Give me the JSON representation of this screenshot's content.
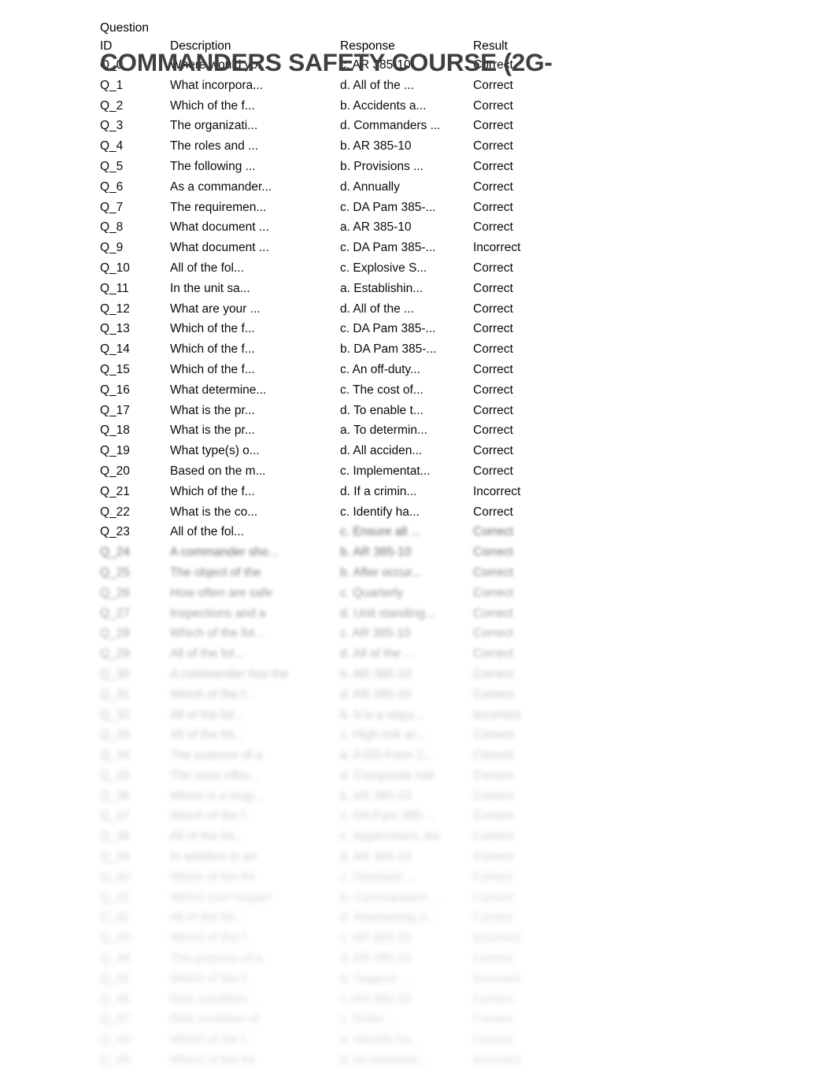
{
  "document": {
    "title": "COMMANDERS SAFETY COURSE (2G-",
    "background_color": "#ffffff",
    "title_color": "#3f3f3f",
    "text_color": "#0a0a0a"
  },
  "table": {
    "headers": {
      "id_line1": "Question",
      "id_line2": "ID",
      "description": "Description",
      "response": "Response",
      "result": "Result"
    },
    "rows": [
      {
        "id": "Q_0",
        "description": "Where would yo...",
        "response": "c. AR 385-10",
        "result": "Correct",
        "blur": 0
      },
      {
        "id": "Q_1",
        "description": "What incorpora...",
        "response": "d. All of the ...",
        "result": "Correct",
        "blur": 0
      },
      {
        "id": "Q_2",
        "description": "Which of the f...",
        "response": "b. Accidents a...",
        "result": "Correct",
        "blur": 0
      },
      {
        "id": "Q_3",
        "description": "The organizati...",
        "response": "d. Commanders ...",
        "result": "Correct",
        "blur": 0
      },
      {
        "id": "Q_4",
        "description": "The roles and ...",
        "response": "b. AR 385-10",
        "result": "Correct",
        "blur": 0
      },
      {
        "id": "Q_5",
        "description": "The following ...",
        "response": "b. Provisions ...",
        "result": "Correct",
        "blur": 0
      },
      {
        "id": "Q_6",
        "description": "As a commander...",
        "response": "d. Annually",
        "result": "Correct",
        "blur": 0
      },
      {
        "id": "Q_7",
        "description": "The requiremen...",
        "response": "c. DA Pam 385-...",
        "result": "Correct",
        "blur": 0
      },
      {
        "id": "Q_8",
        "description": "What document ...",
        "response": "a. AR 385-10",
        "result": "Correct",
        "blur": 0
      },
      {
        "id": "Q_9",
        "description": "What document ...",
        "response": "c. DA Pam 385-...",
        "result": "Incorrect",
        "blur": 0
      },
      {
        "id": "Q_10",
        "description": "All of the fol...",
        "response": "c. Explosive S...",
        "result": "Correct",
        "blur": 0
      },
      {
        "id": "Q_11",
        "description": "In the unit sa...",
        "response": "a. Establishin...",
        "result": "Correct",
        "blur": 0
      },
      {
        "id": "Q_12",
        "description": "What are your ...",
        "response": "d. All of the ...",
        "result": "Correct",
        "blur": 0
      },
      {
        "id": "Q_13",
        "description": "Which of the f...",
        "response": "c. DA Pam 385-...",
        "result": "Correct",
        "blur": 0
      },
      {
        "id": "Q_14",
        "description": "Which of the f...",
        "response": "b. DA Pam 385-...",
        "result": "Correct",
        "blur": 0
      },
      {
        "id": "Q_15",
        "description": "Which of the f...",
        "response": "c. An off-duty...",
        "result": "Correct",
        "blur": 0
      },
      {
        "id": "Q_16",
        "description": "What determine...",
        "response": "c. The cost of...",
        "result": "Correct",
        "blur": 0
      },
      {
        "id": "Q_17",
        "description": "What is the pr...",
        "response": "d. To enable t...",
        "result": "Correct",
        "blur": 0
      },
      {
        "id": "Q_18",
        "description": "What is the pr...",
        "response": "a. To determin...",
        "result": "Correct",
        "blur": 0
      },
      {
        "id": "Q_19",
        "description": "What type(s) o...",
        "response": "d. All acciden...",
        "result": "Correct",
        "blur": 0
      },
      {
        "id": "Q_20",
        "description": "Based on the m...",
        "response": "c. Implementat...",
        "result": "Correct",
        "blur": 0
      },
      {
        "id": "Q_21",
        "description": "Which of the f...",
        "response": "d. If a crimin...",
        "result": "Incorrect",
        "blur": 0
      },
      {
        "id": "Q_22",
        "description": "What is the co...",
        "response": "c. Identify ha...",
        "result": "Correct",
        "blur": 0
      },
      {
        "id": "Q_23",
        "description": "All of the fol...",
        "response": "c. Ensure all ...",
        "result": "Correct",
        "blur": 0,
        "blur_tail": true
      },
      {
        "id": "Q_24",
        "description": "A commander sho...",
        "response": "b. AR 385-10",
        "result": "Correct",
        "blur": 1
      },
      {
        "id": "Q_25",
        "description": "The object of the",
        "response": "b. After occur...",
        "result": "Correct",
        "blur": 1
      },
      {
        "id": "Q_26",
        "description": "How often are safe",
        "response": "c. Quarterly",
        "result": "Correct",
        "blur": 1
      },
      {
        "id": "Q_27",
        "description": "Inspections and a",
        "response": "d. Unit standing...",
        "result": "Correct",
        "blur": 1
      },
      {
        "id": "Q_28",
        "description": "Which of the fol...",
        "response": "c. AR 385-10",
        "result": "Correct",
        "blur": 1
      },
      {
        "id": "Q_29",
        "description": "All of the fol...",
        "response": "d. All of the ...",
        "result": "Correct",
        "blur": 1
      },
      {
        "id": "Q_30",
        "description": "A commander has the",
        "response": "b. AR 385-10",
        "result": "Correct",
        "blur": 2
      },
      {
        "id": "Q_31",
        "description": "Which of the f...",
        "response": "d. AR 385-10",
        "result": "Correct",
        "blur": 2
      },
      {
        "id": "Q_32",
        "description": "All of the fol...",
        "response": "b. It is a requi...",
        "result": "Incorrect",
        "blur": 2
      },
      {
        "id": "Q_33",
        "description": "All of the fol...",
        "response": "c. High-risk ac...",
        "result": "Correct",
        "blur": 2
      },
      {
        "id": "Q_34",
        "description": "The purpose of a",
        "response": "a. A DD Form 2...",
        "result": "Correct",
        "blur": 2
      },
      {
        "id": "Q_35",
        "description": "The most effec...",
        "response": "d. Composite risk",
        "result": "Correct",
        "blur": 2
      },
      {
        "id": "Q_36",
        "description": "Which is a resp...",
        "response": "b. AR 385-10",
        "result": "Correct",
        "blur": 2
      },
      {
        "id": "Q_37",
        "description": "Which of the f...",
        "response": "c. DA Pam 385-...",
        "result": "Correct",
        "blur": 2
      },
      {
        "id": "Q_38",
        "description": "All of the fol...",
        "response": "c. Supervisors, les",
        "result": "Correct",
        "blur": 2
      },
      {
        "id": "Q_39",
        "description": "In addition to an",
        "response": "d. AR 385-10",
        "result": "Correct",
        "blur": 2
      },
      {
        "id": "Q_40",
        "description": "Which of the fol",
        "response": "c. Standard ...",
        "result": "Correct",
        "blur": 3
      },
      {
        "id": "Q_41",
        "description": "Which com respon",
        "response": "b. Commanders ...",
        "result": "Correct",
        "blur": 3
      },
      {
        "id": "Q_42",
        "description": "All of the fol...",
        "response": "d. Maintaining a...",
        "result": "Correct",
        "blur": 3
      },
      {
        "id": "Q_43",
        "description": "Which of the f...",
        "response": "c. AR 385-10",
        "result": "Incorrect",
        "blur": 3
      },
      {
        "id": "Q_44",
        "description": "The purpose of a",
        "response": "d. AR 385-10",
        "result": "Correct",
        "blur": 3
      },
      {
        "id": "Q_45",
        "description": "Which of the f...",
        "response": "b. Support ...",
        "result": "Incorrect",
        "blur": 3
      },
      {
        "id": "Q_46",
        "description": "Risk condition...",
        "response": "c. AR 385-10",
        "result": "Correct",
        "blur": 3
      },
      {
        "id": "Q_47",
        "description": "Risk condition of",
        "response": "c. Rules ...",
        "result": "Correct",
        "blur": 3
      },
      {
        "id": "Q_48",
        "description": "Which of the f...",
        "response": "a. Identify ha...",
        "result": "Correct",
        "blur": 3
      },
      {
        "id": "Q_49",
        "description": "Which of the fol",
        "response": "d. An exploitat...",
        "result": "Incorrect",
        "blur": 3
      }
    ]
  }
}
